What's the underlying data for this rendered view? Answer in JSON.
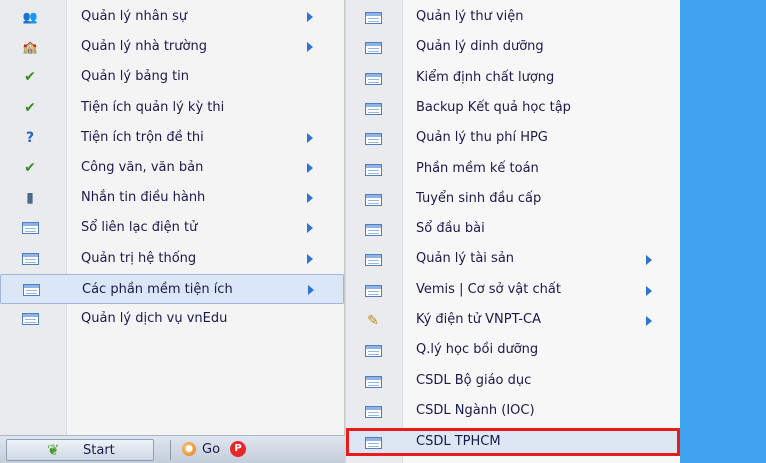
{
  "left_menu": {
    "items": [
      {
        "label": "Quản lý nhân sự",
        "icon": "people-icon",
        "glyph": "👥",
        "arrow": true
      },
      {
        "label": "Quản lý nhà trường",
        "icon": "school-icon",
        "glyph": "🏫",
        "arrow": true
      },
      {
        "label": "Quản lý bảng tin",
        "icon": "checkmark-pen-icon",
        "glyph": "✔",
        "arrow": false
      },
      {
        "label": "Tiện ích quản lý kỳ thi",
        "icon": "checkmark-pen-icon",
        "glyph": "✔",
        "arrow": false
      },
      {
        "label": "Tiện ích trộn đề thi",
        "icon": "question-icon",
        "glyph": "?",
        "arrow": true
      },
      {
        "label": "Công văn, văn bản",
        "icon": "checkmark-pen-icon",
        "glyph": "✔",
        "arrow": true
      },
      {
        "label": "Nhắn tin điều hành",
        "icon": "mobile-phone-icon",
        "glyph": "▮",
        "arrow": true
      },
      {
        "label": "Sổ liên lạc điện tử",
        "icon": "window-icon",
        "arrow": true
      },
      {
        "label": "Quản trị hệ thống",
        "icon": "window-icon",
        "arrow": true
      },
      {
        "label": "Các phần mềm tiện ích",
        "icon": "window-icon",
        "arrow": true
      },
      {
        "label": "Quản lý dịch vụ vnEdu",
        "icon": "window-icon",
        "arrow": false
      }
    ]
  },
  "sub_menu": {
    "items": [
      {
        "label": "Quản lý thư viện",
        "icon": "window-icon",
        "arrow": false
      },
      {
        "label": "Quản lý dinh dưỡng",
        "icon": "window-icon",
        "arrow": false
      },
      {
        "label": "Kiểm định chất lượng",
        "icon": "window-icon",
        "arrow": false
      },
      {
        "label": "Backup Kết quả học tập",
        "icon": "window-icon",
        "arrow": false
      },
      {
        "label": "Quản lý thu phí HPG",
        "icon": "window-icon",
        "arrow": false
      },
      {
        "label": "Phần mềm kế toán",
        "icon": "window-icon",
        "arrow": false
      },
      {
        "label": "Tuyển sinh đầu cấp",
        "icon": "window-icon",
        "arrow": false
      },
      {
        "label": "Sổ đầu bài",
        "icon": "window-icon",
        "arrow": false
      },
      {
        "label": "Quản lý tài sản",
        "icon": "window-icon",
        "arrow": true
      },
      {
        "label": "Vemis | Cơ sở vật chất",
        "icon": "window-icon",
        "arrow": true
      },
      {
        "label": "Ký điện tử VNPT-CA",
        "icon": "digital-signature-icon",
        "glyph": "✎",
        "arrow": true
      },
      {
        "label": "Q.lý học bồi dưỡng",
        "icon": "window-icon",
        "arrow": false
      },
      {
        "label": "CSDL Bộ giáo dục",
        "icon": "window-icon",
        "arrow": false
      },
      {
        "label": "CSDL Ngành (IOC)",
        "icon": "window-icon",
        "arrow": false
      },
      {
        "label": "CSDL TPHCM",
        "icon": "window-icon",
        "arrow": false
      }
    ]
  },
  "taskbar": {
    "start_label": "Start",
    "go_label": "Go"
  },
  "colors": {
    "desktop": "#3fa3f0",
    "highlight_box": "#e81c1c",
    "arrow": "#2d74d4"
  }
}
